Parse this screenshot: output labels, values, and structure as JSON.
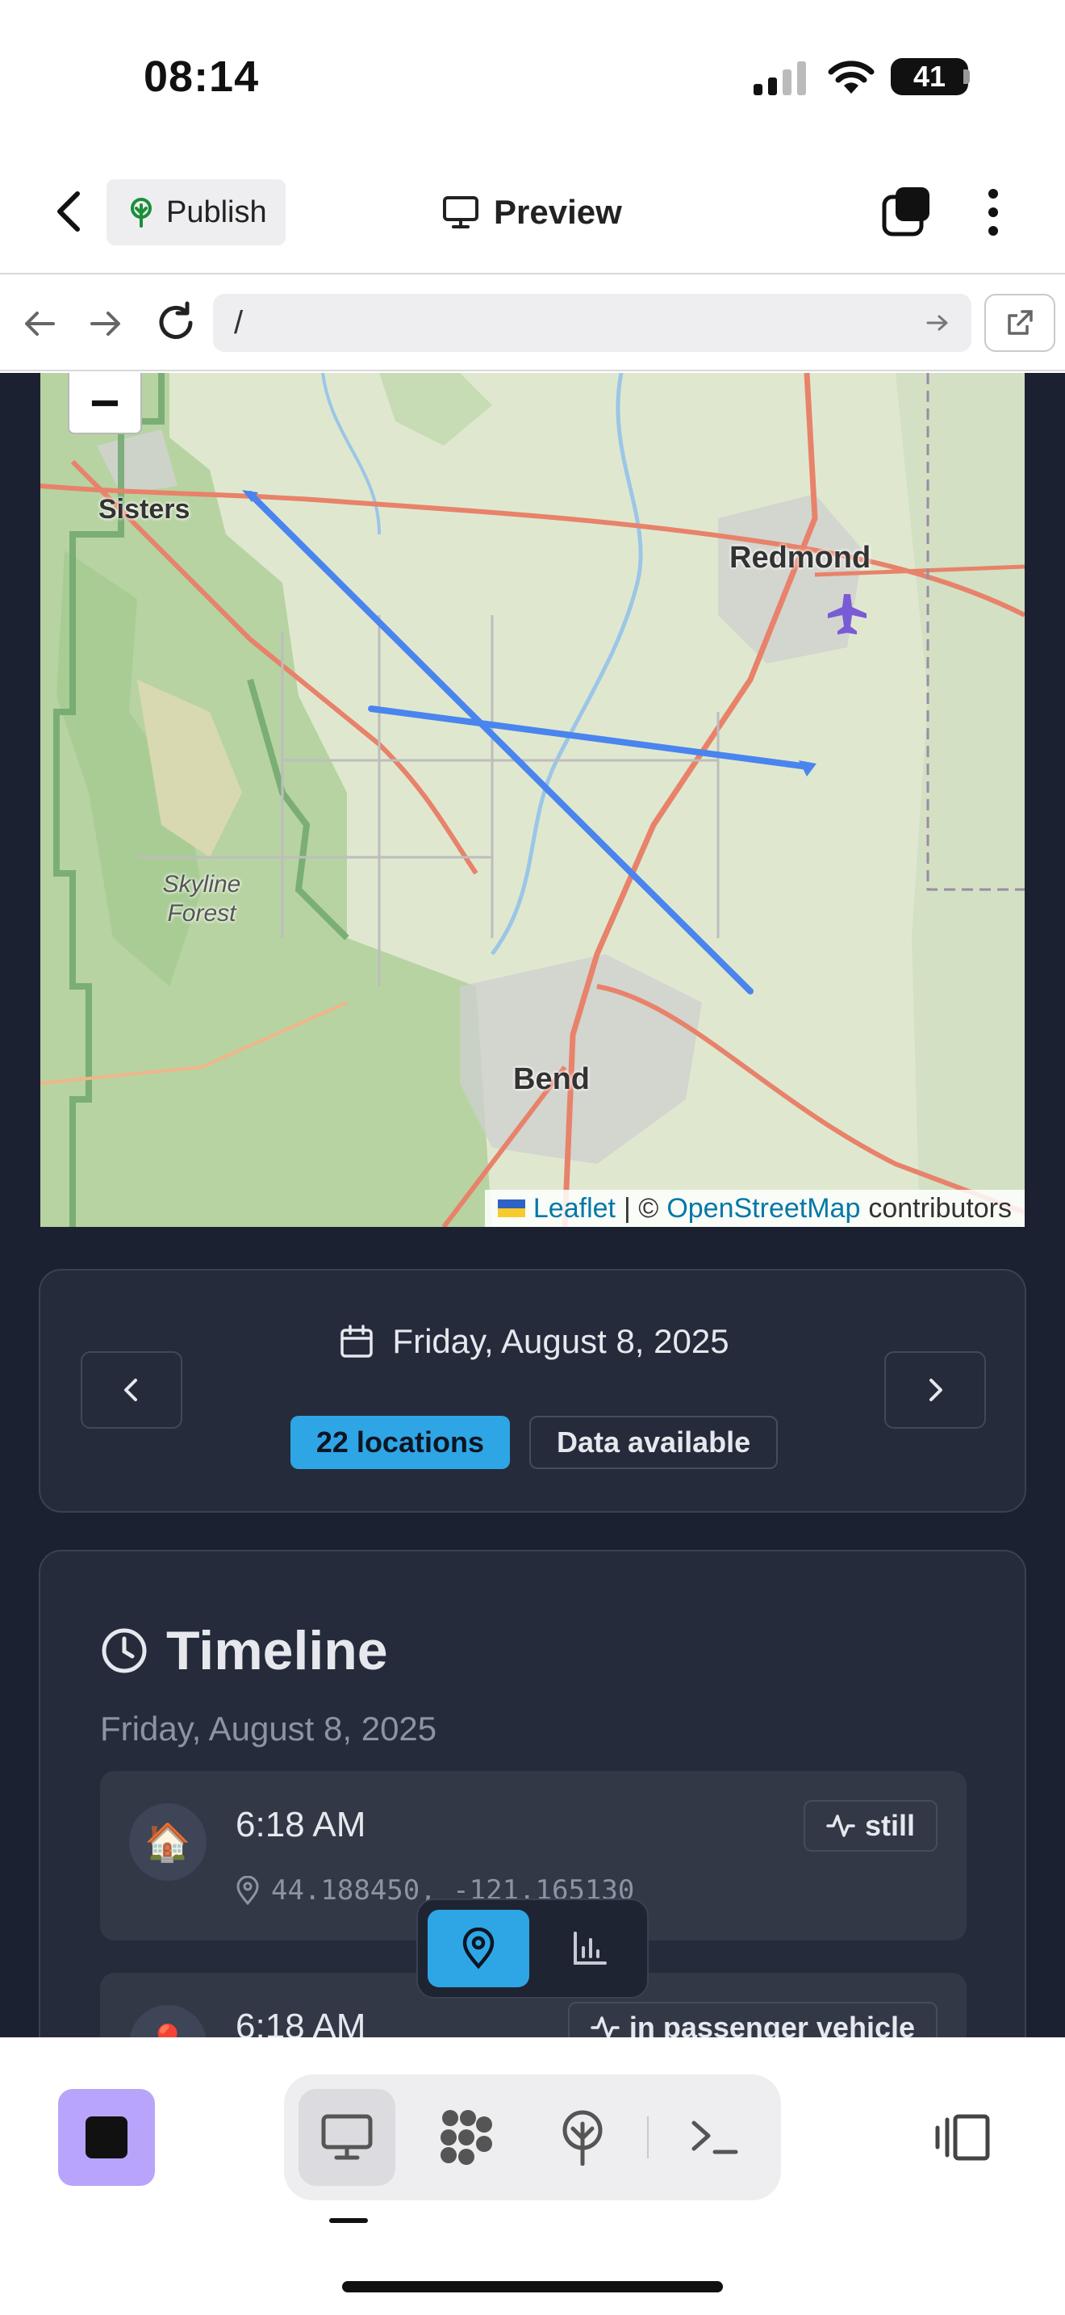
{
  "status_bar": {
    "time": "08:14",
    "battery": "41"
  },
  "header": {
    "publish_label": "Publish",
    "preview_label": "Preview"
  },
  "url_bar": {
    "url": "/"
  },
  "map": {
    "zoom_out": "−",
    "towns": {
      "sisters": "Sisters",
      "redmond": "Redmond",
      "skyline": "Skyline\nForest",
      "bend": "Bend"
    },
    "attribution": {
      "leaflet": "Leaflet",
      "sep": "| ©",
      "osm": "OpenStreetMap",
      "contributors": "contributors"
    }
  },
  "date_card": {
    "date": "Friday, August 8, 2025",
    "count_badge": "22 locations",
    "status_badge": "Data available"
  },
  "timeline": {
    "title": "Timeline",
    "date": "Friday, August 8, 2025",
    "entries": [
      {
        "icon": "🏠",
        "time": "6:18 AM",
        "coords": "44.188450, -121.165130",
        "activity": "still"
      },
      {
        "icon": "📍",
        "time": "6:18 AM",
        "coords": "",
        "activity": "in passenger vehicle"
      }
    ]
  },
  "colors": {
    "accent": "#2ea6e6",
    "background": "#1b2130",
    "card": "#252b3a",
    "stop_button": "#b9a4fb",
    "route": "#4a84ee"
  }
}
